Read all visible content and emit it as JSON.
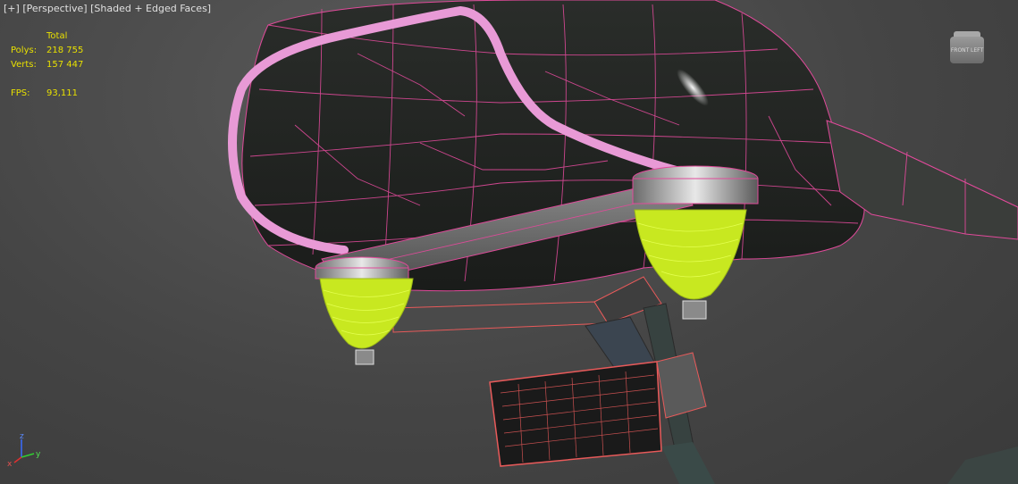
{
  "viewport": {
    "label_plus": "[+]",
    "label_view": "[Perspective]",
    "label_shading": "[Shaded + Edged Faces]"
  },
  "stats": {
    "header": "Total",
    "polys_label": "Polys:",
    "polys_value": "218 755",
    "verts_label": "Verts:",
    "verts_value": "157 447",
    "fps_label": "FPS:",
    "fps_value": "93,111"
  },
  "viewcube": {
    "left_face": "FRONT",
    "right_face": "LEFT"
  },
  "axis_tripod": {
    "z": "z",
    "y": "y",
    "x": "x"
  },
  "colors": {
    "edge_pink": "#e04a9a",
    "tube_pink": "#e89ad6",
    "lens_yellow": "#c8e820",
    "stats_yellow": "#e8e000",
    "selection_red": "#e85a5a"
  }
}
